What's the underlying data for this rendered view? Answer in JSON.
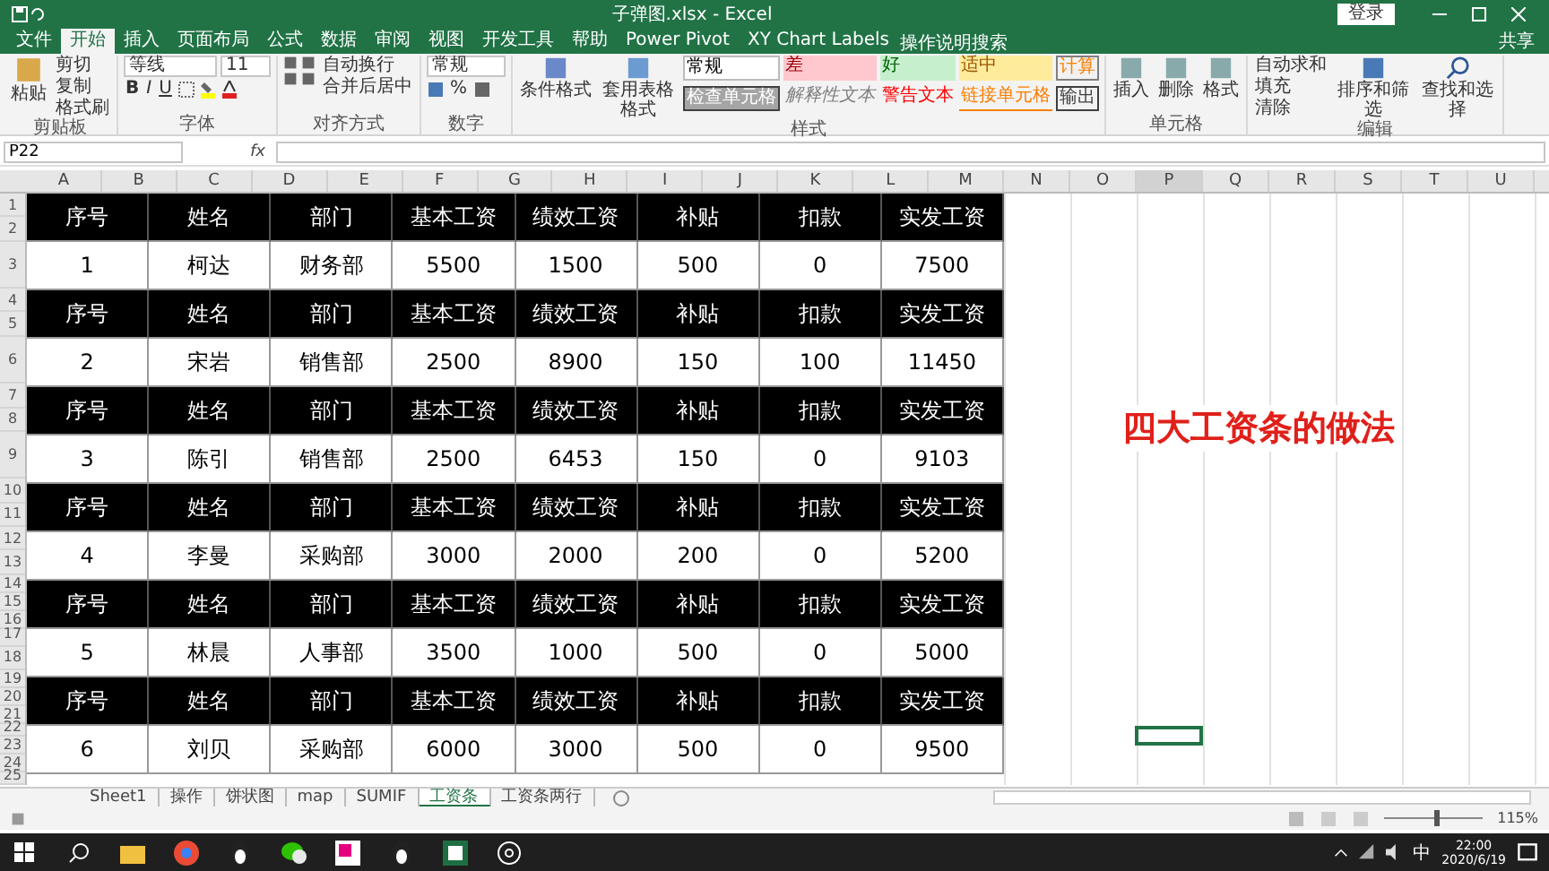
{
  "window": {
    "title": "子弹图.xlsx - Excel",
    "login": "登录",
    "share": "共享"
  },
  "menu_tabs": [
    {
      "label": "文件",
      "selected": false
    },
    {
      "label": "开始",
      "selected": true
    },
    {
      "label": "插入",
      "selected": false
    },
    {
      "label": "页面布局",
      "selected": false
    },
    {
      "label": "公式",
      "selected": false
    },
    {
      "label": "数据",
      "selected": false
    },
    {
      "label": "审阅",
      "selected": false
    },
    {
      "label": "视图",
      "selected": false
    },
    {
      "label": "开发工具",
      "selected": false
    },
    {
      "label": "帮助",
      "selected": false
    },
    {
      "label": "Power Pivot",
      "selected": false
    },
    {
      "label": "XY Chart Labels",
      "selected": false
    }
  ],
  "tell_me": "操作说明搜索",
  "ribbon": {
    "clipboard": {
      "paste": "粘贴",
      "cut": "剪切",
      "copy": "复制",
      "painter": "格式刷",
      "label": "剪贴板"
    },
    "font": {
      "name": "等线",
      "size": "11",
      "bold": "B",
      "italic": "I",
      "underline": "U",
      "label": "字体"
    },
    "alignment": {
      "wrap": "自动换行",
      "merge": "合并后居中",
      "label": "对齐方式"
    },
    "number": {
      "format": "常规",
      "percent": "%",
      "label": "数字"
    },
    "styles": {
      "conditional": "条件格式",
      "table": "套用表格格式",
      "chips": [
        {
          "label": "常规",
          "kind": "normal"
        },
        {
          "label": "差",
          "kind": "bad"
        },
        {
          "label": "好",
          "kind": "good"
        },
        {
          "label": "适中",
          "kind": "neutral"
        },
        {
          "label": "计算",
          "kind": "calc"
        },
        {
          "label": "检查单元格",
          "kind": "check"
        },
        {
          "label": "解释性文本",
          "kind": "explain"
        },
        {
          "label": "警告文本",
          "kind": "warn"
        },
        {
          "label": "链接单元格",
          "kind": "link"
        },
        {
          "label": "输出",
          "kind": "output"
        }
      ],
      "label": "样式"
    },
    "cells": {
      "items": [
        "插入",
        "删除",
        "格式"
      ],
      "label": "单元格"
    },
    "editing": {
      "autosum": "自动求和",
      "fill": "填充",
      "clear": "清除",
      "sort": "排序和筛选",
      "find": "查找和选择",
      "label": "编辑"
    }
  },
  "formula_bar": {
    "name_box": "P22",
    "fx": "fx"
  },
  "columns_left": [
    "A",
    "B",
    "C",
    "D",
    "E",
    "F",
    "G",
    "H",
    "I",
    "J",
    "K",
    "L",
    "M"
  ],
  "columns_right": [
    {
      "label": "N",
      "selected": false
    },
    {
      "label": "O",
      "selected": false
    },
    {
      "label": "P",
      "selected": true
    },
    {
      "label": "Q",
      "selected": false
    },
    {
      "label": "R",
      "selected": false
    },
    {
      "label": "S",
      "selected": false
    },
    {
      "label": "T",
      "selected": false
    },
    {
      "label": "U",
      "selected": false
    }
  ],
  "table": {
    "rows": [
      {
        "kind": "header",
        "row_numbers": [
          "1",
          "2"
        ],
        "cells": [
          "序号",
          "姓名",
          "部门",
          "基本工资",
          "绩效工资",
          "补贴",
          "扣款",
          "实发工资"
        ]
      },
      {
        "kind": "data",
        "row_numbers": [
          "3"
        ],
        "cells": [
          "1",
          "柯达",
          "财务部",
          "5500",
          "1500",
          "500",
          "0",
          "7500"
        ]
      },
      {
        "kind": "header",
        "row_numbers": [
          "4",
          "5"
        ],
        "cells": [
          "序号",
          "姓名",
          "部门",
          "基本工资",
          "绩效工资",
          "补贴",
          "扣款",
          "实发工资"
        ]
      },
      {
        "kind": "data",
        "row_numbers": [
          "6"
        ],
        "cells": [
          "2",
          "宋岩",
          "销售部",
          "2500",
          "8900",
          "150",
          "100",
          "11450"
        ]
      },
      {
        "kind": "header",
        "row_numbers": [
          "7",
          "8"
        ],
        "cells": [
          "序号",
          "姓名",
          "部门",
          "基本工资",
          "绩效工资",
          "补贴",
          "扣款",
          "实发工资"
        ]
      },
      {
        "kind": "data",
        "row_numbers": [
          "9"
        ],
        "cells": [
          "3",
          "陈引",
          "销售部",
          "2500",
          "6453",
          "150",
          "0",
          "9103"
        ]
      },
      {
        "kind": "header",
        "row_numbers": [
          "10",
          "11"
        ],
        "cells": [
          "序号",
          "姓名",
          "部门",
          "基本工资",
          "绩效工资",
          "补贴",
          "扣款",
          "实发工资"
        ]
      },
      {
        "kind": "data",
        "row_numbers": [
          "12",
          "13"
        ],
        "cells": [
          "4",
          "李曼",
          "采购部",
          "3000",
          "2000",
          "200",
          "0",
          "5200"
        ]
      },
      {
        "kind": "header",
        "row_numbers": [
          "14",
          "15",
          "16"
        ],
        "cells": [
          "序号",
          "姓名",
          "部门",
          "基本工资",
          "绩效工资",
          "补贴",
          "扣款",
          "实发工资"
        ]
      },
      {
        "kind": "data",
        "row_numbers": [
          "17",
          "18"
        ],
        "cells": [
          "5",
          "林晨",
          "人事部",
          "3500",
          "1000",
          "500",
          "0",
          "5000"
        ]
      },
      {
        "kind": "header",
        "row_numbers": [
          "19",
          "20",
          "21"
        ],
        "cells": [
          "序号",
          "姓名",
          "部门",
          "基本工资",
          "绩效工资",
          "补贴",
          "扣款",
          "实发工资"
        ]
      },
      {
        "kind": "data",
        "row_numbers": [
          "22",
          "23",
          "24"
        ],
        "cells": [
          "6",
          "刘贝",
          "采购部",
          "6000",
          "3000",
          "500",
          "0",
          "9500"
        ]
      }
    ],
    "trailing_rows": [
      "25"
    ]
  },
  "note": "四大工资条的做法",
  "sheets": [
    {
      "label": "Sheet1",
      "selected": false
    },
    {
      "label": "操作",
      "selected": false
    },
    {
      "label": "饼状图",
      "selected": false
    },
    {
      "label": "map",
      "selected": false
    },
    {
      "label": "SUMIF",
      "selected": false
    },
    {
      "label": "工资条",
      "selected": true
    },
    {
      "label": "工资条两行",
      "selected": false
    }
  ],
  "status_bar": {
    "zoom": "115%",
    "level": 0.5
  },
  "taskbar": {
    "ime": "中",
    "time": "22:00",
    "date": "2020/6/19"
  }
}
